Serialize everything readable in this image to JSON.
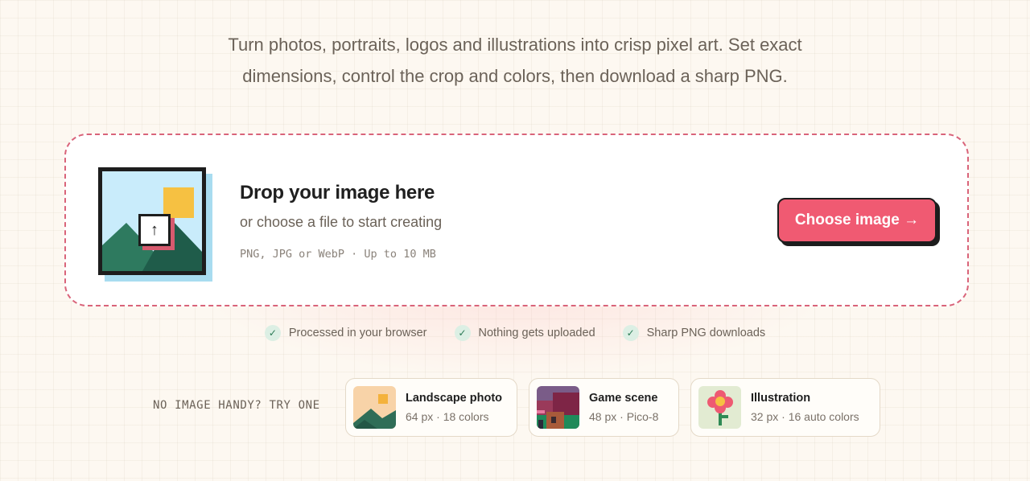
{
  "lead": {
    "line1": "Turn photos, portraits, logos and illustrations into crisp pixel art. Set exact",
    "line2": "dimensions, control the crop and colors, then download a sharp PNG."
  },
  "dropzone": {
    "title": "Drop your image here",
    "subtitle": "or choose a file to start creating",
    "hint": "PNG, JPG or WebP · Up to 10 MB",
    "upload_icon": "↑",
    "button_label": "Choose image →"
  },
  "features": [
    {
      "label": "Processed in your browser",
      "icon": "check-icon"
    },
    {
      "label": "Nothing gets uploaded",
      "icon": "check-icon"
    },
    {
      "label": "Sharp PNG downloads",
      "icon": "check-icon"
    }
  ],
  "samples": {
    "label": "NO IMAGE HANDY? TRY ONE",
    "items": [
      {
        "name": "Landscape photo",
        "meta": "64 px · 18 colors"
      },
      {
        "name": "Game scene",
        "meta": "48 px · Pico-8"
      },
      {
        "name": "Illustration",
        "meta": "32 px · 16 auto colors"
      }
    ]
  },
  "colors": {
    "accent": "#f05a72",
    "dash": "#d9647a",
    "ink": "#1d1d1d",
    "check": "#2b7a55"
  }
}
